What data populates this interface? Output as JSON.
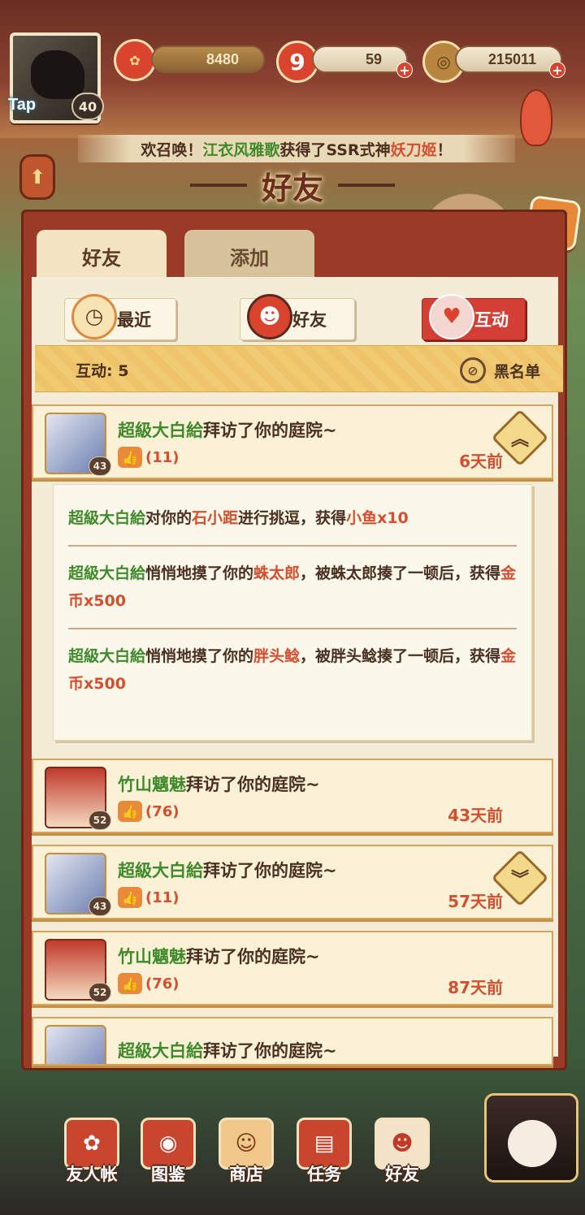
{
  "player": {
    "tap_label": "Tap",
    "level": "40"
  },
  "resources": [
    {
      "name": "coupon",
      "value": "8480",
      "icon": "red-flower-icon"
    },
    {
      "name": "fish",
      "value": "59",
      "icon": "red-nine-icon"
    },
    {
      "name": "gold",
      "value": "215011",
      "icon": "coin-icon"
    }
  ],
  "marquee": {
    "pre": "欢召唤！",
    "player": "江衣风雅歌",
    "mid": "获得了SSR式神",
    "shikigami": "妖刀姬",
    "post": "！"
  },
  "title": "好友",
  "tabs": [
    {
      "label": "好友",
      "active": true
    },
    {
      "label": "添加",
      "active": false
    }
  ],
  "subtabs": [
    {
      "label": "最近",
      "icon": "clock-icon"
    },
    {
      "label": "好友",
      "icon": "daruma-icon"
    },
    {
      "label": "互动",
      "icon": "gift-icon",
      "active": true
    }
  ],
  "interaction": {
    "count_label": "互动: 5",
    "blacklist_label": "黑名单"
  },
  "entries": [
    {
      "name": "超級大白給",
      "action": "拜访了你的庭院~",
      "likes": "(11)",
      "time": "6天前",
      "level": "43",
      "expanded": true
    },
    {
      "name": "竹山魑魅",
      "action": "拜访了你的庭院~",
      "likes": "(76)",
      "time": "43天前",
      "level": "52",
      "expanded": false
    },
    {
      "name": "超級大白給",
      "action": "拜访了你的庭院~",
      "likes": "(11)",
      "time": "57天前",
      "level": "43",
      "expanded": false
    },
    {
      "name": "竹山魑魅",
      "action": "拜访了你的庭院~",
      "likes": "(76)",
      "time": "87天前",
      "level": "52",
      "expanded": false
    },
    {
      "name": "超級大白給",
      "action": "拜访了你的庭院~",
      "likes": "",
      "time": "",
      "level": "",
      "expanded": false
    }
  ],
  "details": [
    {
      "name": "超級大白給",
      "a": "对你的",
      "target": "石小距",
      "b": "进行挑逗，获得",
      "reward": "小鱼x10",
      "c": ""
    },
    {
      "name": "超級大白給",
      "a": "悄悄地摸了你的",
      "target": "蛛太郎",
      "b": "，被蛛太郎揍了一顿后，获得",
      "reward": "金币x500",
      "c": ""
    },
    {
      "name": "超級大白給",
      "a": "悄悄地摸了你的",
      "target": "胖头鲶",
      "b": "，被胖头鲶揍了一顿后，获得",
      "reward": "金币x500",
      "c": ""
    }
  ],
  "nav": [
    {
      "label": "友人帐",
      "icon": "book-icon"
    },
    {
      "label": "图鉴",
      "icon": "eye-book-icon"
    },
    {
      "label": "商店",
      "icon": "maneki-neko-icon"
    },
    {
      "label": "任务",
      "icon": "scroll-icon"
    },
    {
      "label": "好友",
      "icon": "friends-icon"
    }
  ],
  "colors": {
    "accent_red": "#d2502f",
    "name_green": "#3f8a2a",
    "panel": "#9b3b27"
  }
}
